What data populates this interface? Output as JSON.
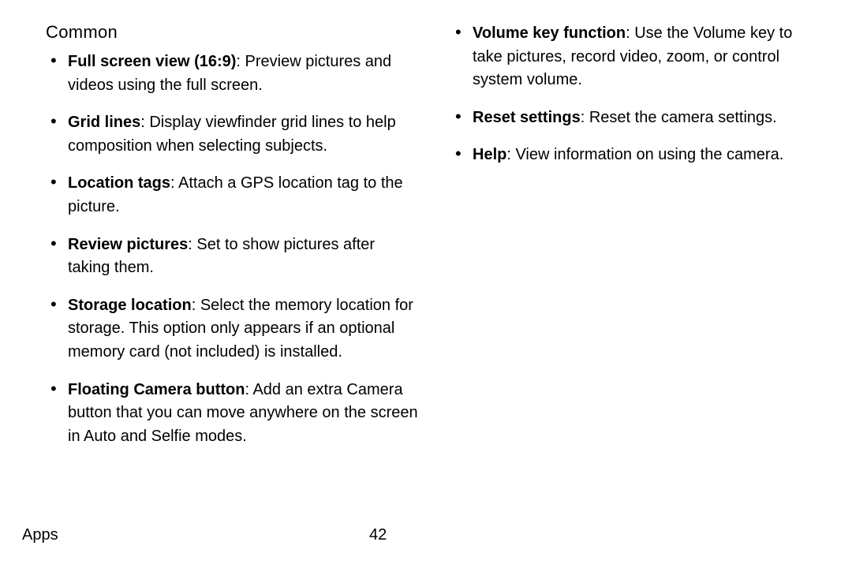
{
  "heading": "Common",
  "left_items": [
    {
      "term": "Full screen view (16:9)",
      "desc": ": Preview pictures and videos using the full screen."
    },
    {
      "term": "Grid lines",
      "desc": ": Display viewfinder grid lines to help composition when selecting subjects."
    },
    {
      "term": "Location tags",
      "desc": ": Attach a GPS location tag to the picture."
    },
    {
      "term": "Review pictures",
      "desc": ": Set to show pictures after taking them."
    },
    {
      "term": "Storage location",
      "desc": ": Select the memory location for storage. This option only appears if an optional memory card (not included) is installed."
    },
    {
      "term": "Floating Camera button",
      "desc": ": Add an extra Camera button that you can move anywhere on the screen in Auto and Selfie modes."
    }
  ],
  "right_items": [
    {
      "term": "Volume key function",
      "desc": ": Use the Volume key to take pictures, record video, zoom, or control system volume."
    },
    {
      "term": "Reset settings",
      "desc": ": Reset the camera settings."
    },
    {
      "term": "Help",
      "desc": ": View information on using the camera."
    }
  ],
  "footer": {
    "section": "Apps",
    "page": "42"
  }
}
